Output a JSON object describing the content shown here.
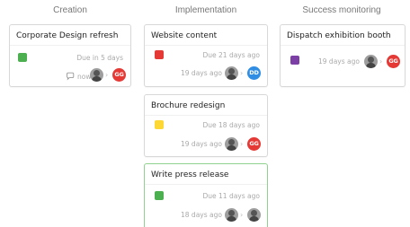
{
  "columns": [
    {
      "title": "Creation"
    },
    {
      "title": "Implementation"
    },
    {
      "title": "Success monitoring"
    }
  ],
  "colors": {
    "green": "#4caf50",
    "red": "#e53935",
    "yellow": "#fdd835",
    "purple": "#7b3fa6",
    "badge_red": "#e53935",
    "badge_blue": "#2f8de4"
  },
  "cards": {
    "corporate": {
      "title": "Corporate Design refresh",
      "due": "Due in 5 days",
      "activity": "now",
      "assignee_initials": "GG"
    },
    "website": {
      "title": "Website content",
      "due": "Due 21 days ago",
      "activity": "19 days ago",
      "assignee_initials": "DD"
    },
    "brochure": {
      "title": "Brochure redesign",
      "due": "Due 18 days ago",
      "activity": "19 days ago",
      "assignee_initials": "GG"
    },
    "press": {
      "title": "Write press release",
      "due": "Due 11 days ago",
      "activity": "18 days ago"
    },
    "dispatch": {
      "title": "Dispatch exhibition booth",
      "activity": "19 days ago",
      "assignee_initials": "GG"
    }
  }
}
